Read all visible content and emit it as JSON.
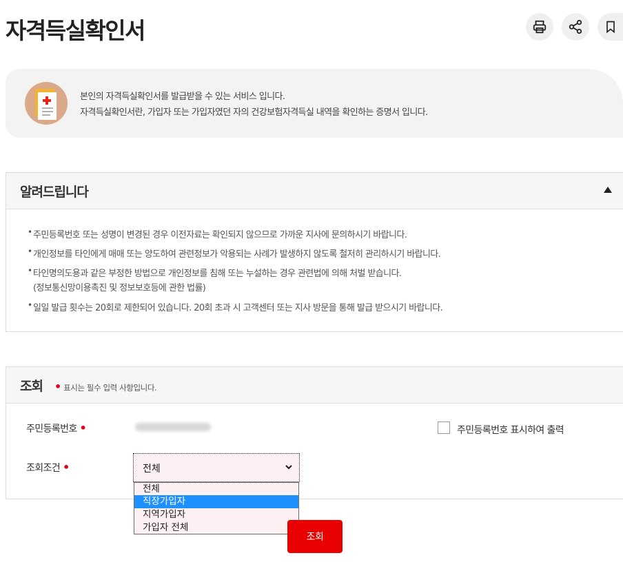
{
  "page": {
    "title": "자격득실확인서"
  },
  "toolbar": {
    "print_icon": "printer-icon",
    "share_icon": "share-icon",
    "bookmark_icon": "bookmark-icon"
  },
  "intro": {
    "icon": "medical-certificate-icon",
    "line1": "본인의 자격득실확인서를 발급받을 수 있는 서비스 입니다.",
    "line2": "자격득실확인서란, 가입자 또는 가입자였던 자의 건강보험자격득실 내역을 확인하는 증명서 입니다."
  },
  "notice": {
    "title": "알려드립니다",
    "toggle_icon": "collapse-up-icon",
    "items": [
      "주민등록번호 또는 성명이 변경된 경우 이전자료는 확인되지 않으므로 가까운 지사에 문의하시기 바랍니다.",
      "개인정보를 타인에게 매매 또는 양도하여 관련정보가 악용되는 사례가 발생하지 않도록 철저히 관리하시기 바랍니다.",
      "타인명의도용과 같은 부정한 방법으로 개인정보를 침해 또는 누설하는 경우 관련법에 의해 처벌 받습니다.",
      "일일 발급 횟수는 20회로 제한되어 있습니다. 20회 초과 시 고객센터 또는 지사 방문을 통해 발급 받으시기 바랍니다."
    ],
    "item3_sub": "(정보통신망이용촉진 및 정보보호등에 관한 법률)"
  },
  "search": {
    "title": "조회",
    "required_note": "표시는 필수 입력 사항입니다.",
    "ssn_label": "주민등록번호",
    "print_ssn_label": "주민등록번호 표시하여 출력",
    "condition_label": "조회조건",
    "condition_value": "전체",
    "options": [
      "전체",
      "직장가입자",
      "지역가입자",
      "가입자 전체"
    ],
    "selected_option_index": 1,
    "submit_label": "조회"
  },
  "colors": {
    "accent_red": "#e90000",
    "required_dot": "#e0001b",
    "option_highlight": "#1e90ff"
  }
}
